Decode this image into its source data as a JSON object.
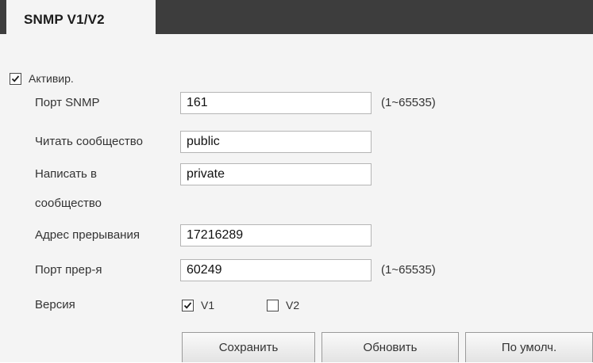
{
  "tab": {
    "label": "SNMP V1/V2"
  },
  "enable": {
    "label": "Активир.",
    "checked": true
  },
  "fields": {
    "snmp_port": {
      "label": "Порт SNMP",
      "value": "161",
      "range": "(1~65535)"
    },
    "read_community": {
      "label": "Читать сообщество",
      "value": "public"
    },
    "write_community": {
      "label_line1": "Написать в",
      "label_line2": "сообщество",
      "value": "private"
    },
    "trap_address": {
      "label": "Адрес прерывания",
      "value": "17216289"
    },
    "trap_port": {
      "label": "Порт прер-я",
      "value": "60249",
      "range": "(1~65535)"
    }
  },
  "version": {
    "label": "Версия",
    "options": [
      {
        "label": "V1",
        "checked": true
      },
      {
        "label": "V2",
        "checked": false
      }
    ]
  },
  "buttons": {
    "save": "Сохранить",
    "refresh": "Обновить",
    "default": "По умолч."
  },
  "colors": {
    "tab_bar": "#3d3d3d",
    "panel": "#f4f4f4"
  }
}
